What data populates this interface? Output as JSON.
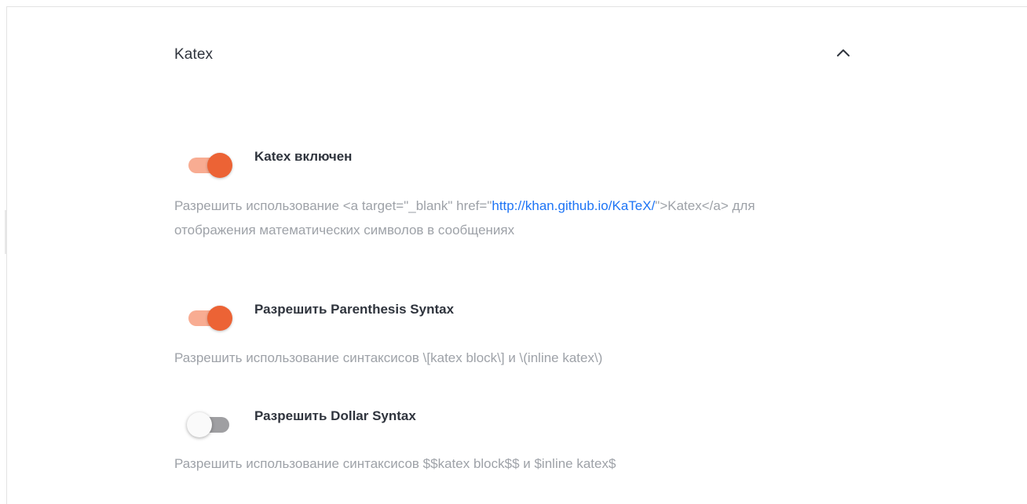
{
  "section": {
    "title": "Katex",
    "expanded": true
  },
  "colors": {
    "accent": "#ec6335",
    "accent_track": "#f8ac92",
    "link": "#1d74f5",
    "hint": "#9ea2a8",
    "text": "#2f343d"
  },
  "settings": [
    {
      "label": "Katex включен",
      "enabled": true,
      "description_before": "Разрешить использование <a target=\"_blank\" href=\"",
      "description_link": "http://khan.github.io/KaTeX/",
      "description_after": "\">Katex</a> для отображения математических символов в сообщениях"
    },
    {
      "label": "Разрешить Parenthesis Syntax",
      "enabled": true,
      "description": "Разрешить использование синтаксисов \\[katex block\\] и \\(inline katex\\)"
    },
    {
      "label": "Разрешить Dollar Syntax",
      "enabled": false,
      "description": "Разрешить использование синтаксисов $$katex block$$ и $inline katex$"
    }
  ],
  "icons": {
    "collapse": "chevron-up-icon"
  }
}
